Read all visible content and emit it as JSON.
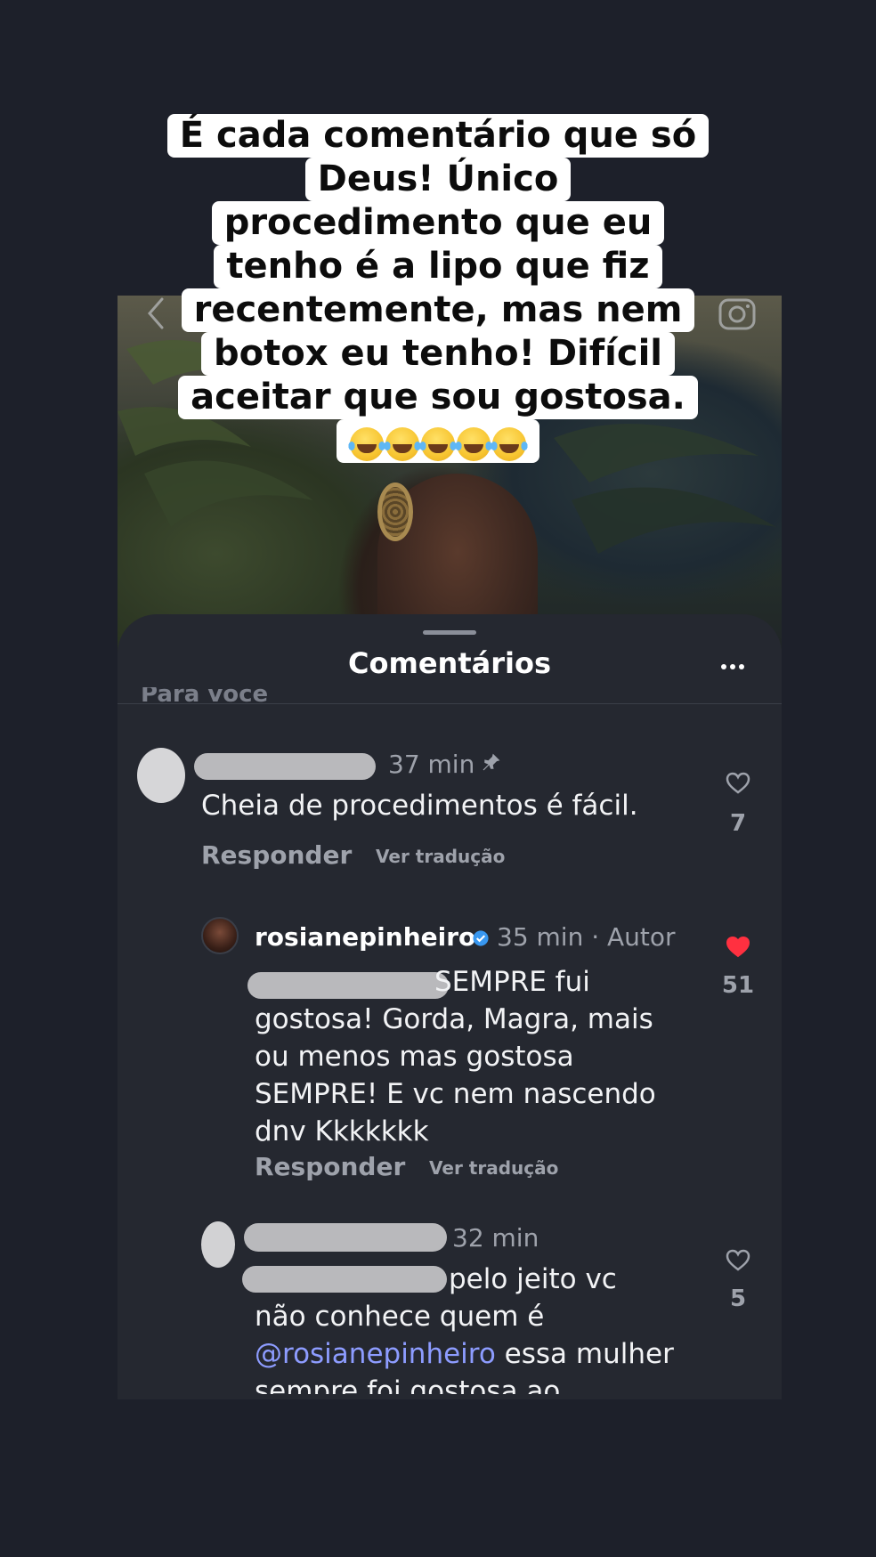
{
  "caption": {
    "lines": [
      "É cada comentário que só",
      "Deus! Único",
      "procedimento que eu",
      "tenho é a lipo que fiz",
      "recentemente, mas nem",
      "botox eu tenho! Difícil",
      "aceitar que sou gostosa."
    ],
    "emoji": "😂😂😂😂😂"
  },
  "sheet": {
    "title": "Comentários",
    "section_label": "Para você"
  },
  "comments": [
    {
      "time": "37 min",
      "text": "Cheia de procedimentos é fácil.",
      "reply_label": "Responder",
      "translate_label": "Ver tradução",
      "likes": "7",
      "liked": false
    },
    {
      "username": "rosianepinheiro",
      "time_author": "35 min · Autor",
      "text_lines": [
        "SEMPRE fui",
        "gostosa! Gorda, Magra, mais",
        "ou menos mas gostosa",
        "SEMPRE! E vc nem nascendo",
        "dnv Kkkkkkk"
      ],
      "reply_label": "Responder",
      "translate_label": "Ver tradução",
      "likes": "51",
      "liked": true
    },
    {
      "time": "32 min",
      "text_line1": "pelo jeito vc",
      "text_line2": "não conhece quem é",
      "mention": "@rosianepinheiro",
      "text_line3_rest": " essa mulher",
      "text_line4": "sempre foi gostosa ao extremo",
      "likes": "5",
      "liked": false
    }
  ],
  "colors": {
    "background": "#1d202a",
    "sheet": "#252830",
    "mention": "#8d9cff",
    "liked": "#ff3040"
  }
}
